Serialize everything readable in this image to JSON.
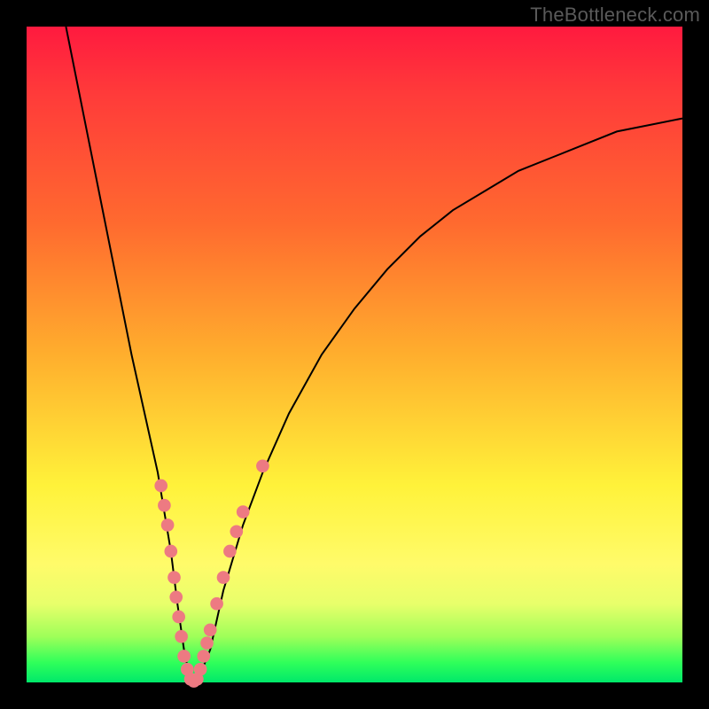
{
  "watermark": "TheBottleneck.com",
  "chart_data": {
    "type": "line",
    "title": "",
    "xlabel": "",
    "ylabel": "",
    "xlim": [
      0,
      100
    ],
    "ylim": [
      0,
      100
    ],
    "series": [
      {
        "name": "bottleneck-curve",
        "x": [
          6,
          8,
          10,
          12,
          14,
          16,
          18,
          20,
          22,
          23,
          24,
          25,
          26,
          28,
          30,
          33,
          36,
          40,
          45,
          50,
          55,
          60,
          65,
          70,
          75,
          80,
          85,
          90,
          95,
          100
        ],
        "y": [
          100,
          90,
          80,
          70,
          60,
          50,
          41,
          32,
          20,
          12,
          5,
          0,
          0,
          5,
          14,
          24,
          32,
          41,
          50,
          57,
          63,
          68,
          72,
          75,
          78,
          80,
          82,
          84,
          85,
          86
        ]
      }
    ],
    "markers": [
      {
        "x": 20.5,
        "y": 30,
        "r": 1.1
      },
      {
        "x": 21.0,
        "y": 27,
        "r": 1.1
      },
      {
        "x": 21.5,
        "y": 24,
        "r": 1.1
      },
      {
        "x": 22.0,
        "y": 20,
        "r": 1.1
      },
      {
        "x": 22.5,
        "y": 16,
        "r": 1.1
      },
      {
        "x": 22.8,
        "y": 13,
        "r": 1.1
      },
      {
        "x": 23.2,
        "y": 10,
        "r": 1.1
      },
      {
        "x": 23.6,
        "y": 7,
        "r": 1.1
      },
      {
        "x": 24.0,
        "y": 4,
        "r": 1.1
      },
      {
        "x": 24.5,
        "y": 2,
        "r": 1.1
      },
      {
        "x": 25.0,
        "y": 0.5,
        "r": 1.1
      },
      {
        "x": 25.5,
        "y": 0.2,
        "r": 1.1
      },
      {
        "x": 26.0,
        "y": 0.5,
        "r": 1.1
      },
      {
        "x": 26.5,
        "y": 2,
        "r": 1.1
      },
      {
        "x": 27.0,
        "y": 4,
        "r": 1.1
      },
      {
        "x": 27.5,
        "y": 6,
        "r": 1.1
      },
      {
        "x": 28.0,
        "y": 8,
        "r": 1.1
      },
      {
        "x": 29.0,
        "y": 12,
        "r": 1.1
      },
      {
        "x": 30.0,
        "y": 16,
        "r": 1.1
      },
      {
        "x": 31.0,
        "y": 20,
        "r": 1.1
      },
      {
        "x": 32.0,
        "y": 23,
        "r": 1.1
      },
      {
        "x": 33.0,
        "y": 26,
        "r": 1.1
      },
      {
        "x": 36.0,
        "y": 33,
        "r": 1.1
      }
    ],
    "marker_color": "#ed7a82",
    "curve_color": "#000000",
    "curve_width": 2
  }
}
